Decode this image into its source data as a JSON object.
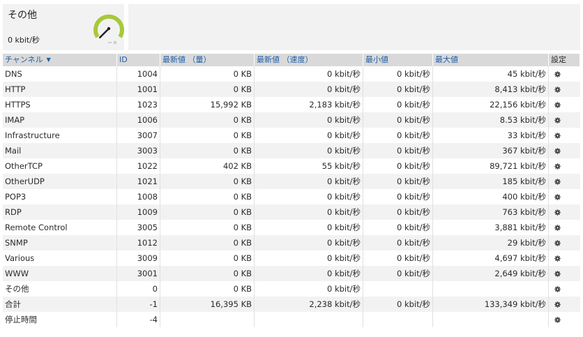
{
  "tile": {
    "title": "その他",
    "value": "0 kbit/秒",
    "gauge_level": 0,
    "accent": "#a8c83a"
  },
  "table": {
    "headers": {
      "channel": "チャンネル",
      "id": "ID",
      "last_volume": "最新値 （量）",
      "last_speed": "最新値 （速度）",
      "min": "最小値",
      "max": "最大値",
      "settings": "設定"
    },
    "rows": [
      {
        "channel": "DNS",
        "id": "1004",
        "vol": "0 KB",
        "spd": "0 kbit/秒",
        "min": "0 kbit/秒",
        "max": "45 kbit/秒"
      },
      {
        "channel": "HTTP",
        "id": "1001",
        "vol": "0 KB",
        "spd": "0 kbit/秒",
        "min": "0 kbit/秒",
        "max": "8,413 kbit/秒"
      },
      {
        "channel": "HTTPS",
        "id": "1023",
        "vol": "15,992 KB",
        "spd": "2,183 kbit/秒",
        "min": "0 kbit/秒",
        "max": "22,156 kbit/秒"
      },
      {
        "channel": "IMAP",
        "id": "1006",
        "vol": "0 KB",
        "spd": "0 kbit/秒",
        "min": "0 kbit/秒",
        "max": "8.53 kbit/秒"
      },
      {
        "channel": "Infrastructure",
        "id": "3007",
        "vol": "0 KB",
        "spd": "0 kbit/秒",
        "min": "0 kbit/秒",
        "max": "33 kbit/秒"
      },
      {
        "channel": "Mail",
        "id": "3003",
        "vol": "0 KB",
        "spd": "0 kbit/秒",
        "min": "0 kbit/秒",
        "max": "367 kbit/秒"
      },
      {
        "channel": "OtherTCP",
        "id": "1022",
        "vol": "402 KB",
        "spd": "55 kbit/秒",
        "min": "0 kbit/秒",
        "max": "89,721 kbit/秒"
      },
      {
        "channel": "OtherUDP",
        "id": "1021",
        "vol": "0 KB",
        "spd": "0 kbit/秒",
        "min": "0 kbit/秒",
        "max": "185 kbit/秒"
      },
      {
        "channel": "POP3",
        "id": "1008",
        "vol": "0 KB",
        "spd": "0 kbit/秒",
        "min": "0 kbit/秒",
        "max": "400 kbit/秒"
      },
      {
        "channel": "RDP",
        "id": "1009",
        "vol": "0 KB",
        "spd": "0 kbit/秒",
        "min": "0 kbit/秒",
        "max": "763 kbit/秒"
      },
      {
        "channel": "Remote Control",
        "id": "3005",
        "vol": "0 KB",
        "spd": "0 kbit/秒",
        "min": "0 kbit/秒",
        "max": "3,881 kbit/秒"
      },
      {
        "channel": "SNMP",
        "id": "1012",
        "vol": "0 KB",
        "spd": "0 kbit/秒",
        "min": "0 kbit/秒",
        "max": "29 kbit/秒"
      },
      {
        "channel": "Various",
        "id": "3009",
        "vol": "0 KB",
        "spd": "0 kbit/秒",
        "min": "0 kbit/秒",
        "max": "4,697 kbit/秒"
      },
      {
        "channel": "WWW",
        "id": "3001",
        "vol": "0 KB",
        "spd": "0 kbit/秒",
        "min": "0 kbit/秒",
        "max": "2,649 kbit/秒"
      },
      {
        "channel": "その他",
        "id": "0",
        "vol": "0 KB",
        "spd": "0 kbit/秒",
        "min": "",
        "max": ""
      },
      {
        "channel": "合計",
        "id": "-1",
        "vol": "16,395 KB",
        "spd": "2,238 kbit/秒",
        "min": "0 kbit/秒",
        "max": "133,349 kbit/秒"
      },
      {
        "channel": "停止時間",
        "id": "-4",
        "vol": "",
        "spd": "",
        "min": "",
        "max": ""
      }
    ]
  }
}
